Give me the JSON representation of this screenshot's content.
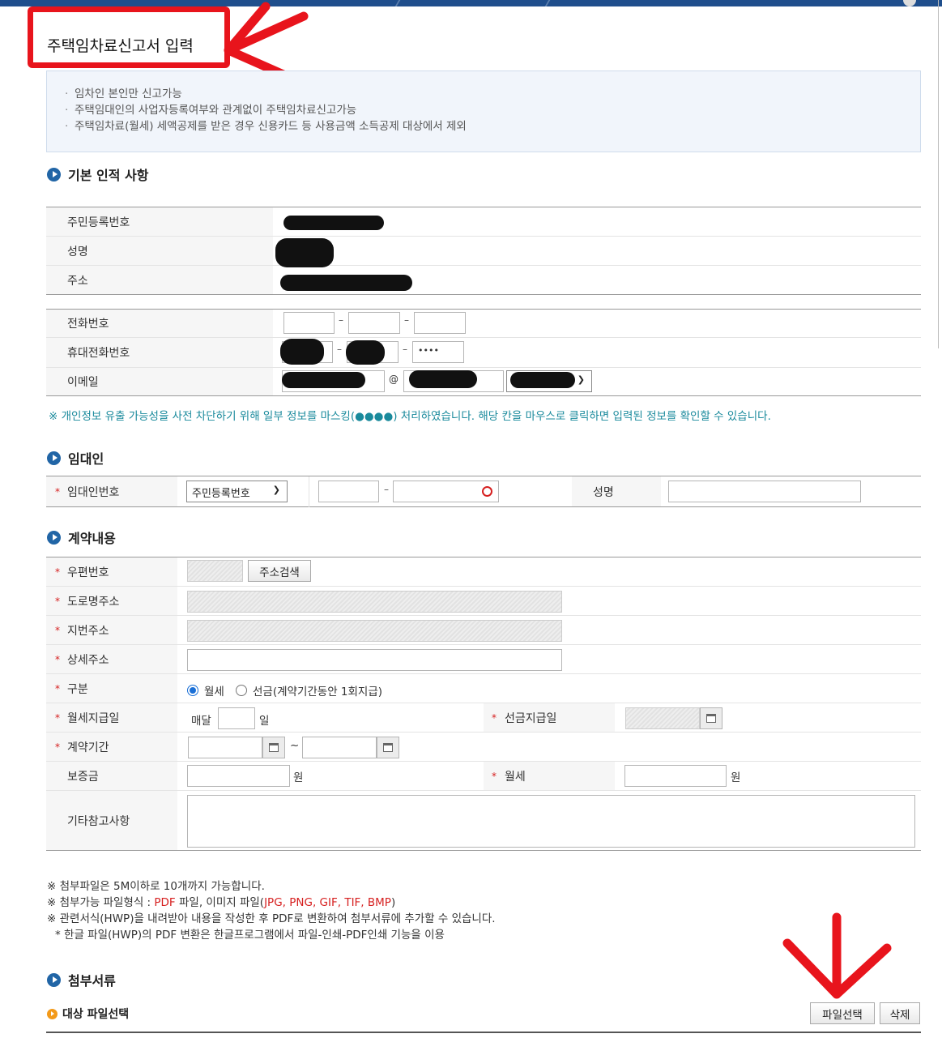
{
  "page_title": "주택임차료신고서 입력",
  "info_items": [
    "임차인 본인만 신고가능",
    "주택임대인의 사업자등록여부와 관계없이 주택임차료신고가능",
    "주택임차료(월세) 세액공제를 받은 경우 신용카드 등 사용금액 소득공제 대상에서 제외"
  ],
  "basic": {
    "heading": "기본 인적 사항",
    "resident_no_label": "주민등록번호",
    "name_label": "성명",
    "address_label": "주소",
    "phone_label": "전화번호",
    "mobile_label": "휴대전화번호",
    "mobile_last": "••••",
    "email_label": "이메일",
    "email_at": "@"
  },
  "privacy_notice": "※ 개인정보 유출 가능성을 사전 차단하기 위해 일부 정보를 마스킹(●●●●) 처리하였습니다. 해당 칸을 마우스로 클릭하면 입력된 정보를 확인할 수 있습니다.",
  "landlord": {
    "heading": "임대인",
    "id_label": "임대인번호",
    "id_type_selected": "주민등록번호",
    "name_label": "성명"
  },
  "contract": {
    "heading": "계약내용",
    "zip_label": "우편번호",
    "zip_search_button": "주소검색",
    "road_address_label": "도로명주소",
    "lot_address_label": "지번주소",
    "detail_address_label": "상세주소",
    "type_label": "구분",
    "type_monthly": "월세",
    "type_prepaid": "선금(계약기간동안 1회지급)",
    "monthly_pay_day_label": "월세지급일",
    "monthly_prefix": "매달",
    "day_suffix": "일",
    "prepaid_date_label": "선금지급일",
    "period_label": "계약기간",
    "period_sep": "~",
    "deposit_label": "보증금",
    "won": "원",
    "monthly_rent_label": "월세",
    "remarks_label": "기타참고사항"
  },
  "attach_notes": {
    "line1": "※ 첨부파일은 5M이하로 10개까지 가능합니다.",
    "line2_prefix": "※ 첨부가능 파일형식 : ",
    "line2_pdf": "PDF",
    "line2_mid": " 파일, 이미지 파일(",
    "line2_img": "JPG, PNG, GIF, TIF, BMP",
    "line2_end": ")",
    "line3": "※ 관련서식(HWP)을 내려받아 내용을 작성한 후 PDF로 변환하여 첨부서류에 추가할 수 있습니다.",
    "line4": "* 한글 파일(HWP)의 PDF 변환은 한글프로그램에서 파일-인쇄-PDF인쇄 기능을 이용"
  },
  "attachments": {
    "heading": "첨부서류",
    "sub_heading": "대상 파일선택",
    "select_button": "파일선택",
    "delete_button": "삭제"
  },
  "colors": {
    "annotation_red": "#e8141c",
    "header_blue": "#1f4e8c",
    "notice_teal": "#1a8a9c",
    "required_red": "#d62020"
  }
}
